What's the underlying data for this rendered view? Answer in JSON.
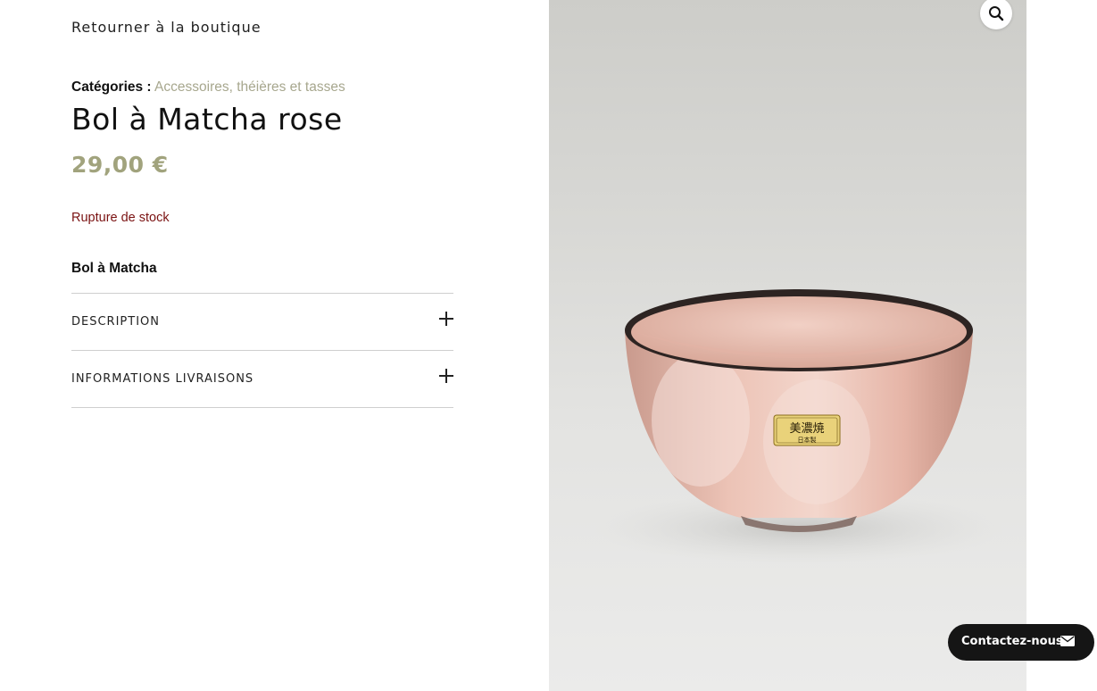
{
  "nav": {
    "back_label": "Retourner à la boutique"
  },
  "product": {
    "categories_label": "Catégories :",
    "categories": [
      "Accessoires",
      "théières et tasses"
    ],
    "category_separator": ",",
    "title": "Bol à Matcha rose",
    "price": "29,00 €",
    "stock_status": "Rupture de stock",
    "short_description": "Bol à Matcha",
    "image_label_jp": "美濃焼",
    "image_label_jp_sub": "日本製"
  },
  "accordion": [
    {
      "label": "DESCRIPTION",
      "icon": "plus-icon",
      "expanded": false
    },
    {
      "label": "INFORMATIONS LIVRAISONS",
      "icon": "plus-icon",
      "expanded": false
    }
  ],
  "gallery": {
    "zoom_icon": "magnifier-icon"
  },
  "contact": {
    "label": "Contactez-nous",
    "icon": "envelope-icon"
  },
  "colors": {
    "price": "#a1a37d",
    "category_link": "#a7a78e",
    "stock": "#7a1212",
    "contact_bg": "#151515",
    "bowl_pink": "#e8b7a8"
  }
}
